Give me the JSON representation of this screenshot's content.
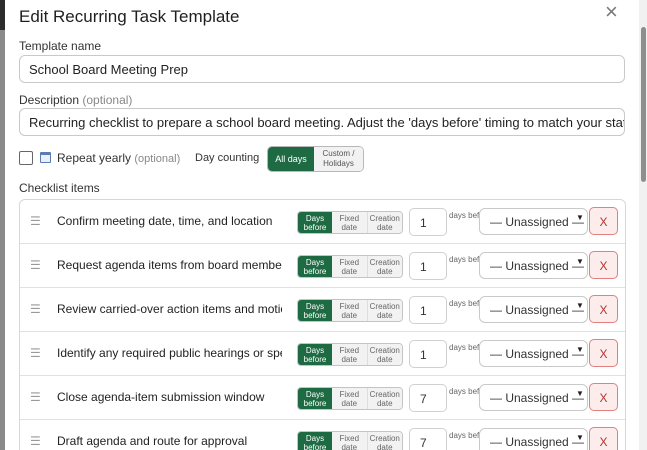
{
  "modal": {
    "title": "Edit Recurring Task Template",
    "close_label": "×"
  },
  "template_name": {
    "label": "Template name",
    "value": "School Board Meeting Prep"
  },
  "description": {
    "label": "Description",
    "optional": "(optional)",
    "value": "Recurring checklist to prepare a school board meeting. Adjust the 'days before' timing to match your state's noti"
  },
  "repeat": {
    "label": "Repeat yearly",
    "optional": "(optional)",
    "checked": false
  },
  "day_counting": {
    "label": "Day counting",
    "options": [
      "All days",
      "Custom / Holidays"
    ],
    "selected": "All days"
  },
  "checklist": {
    "label": "Checklist items",
    "mode_options": [
      "Days before",
      "Fixed date",
      "Creation date"
    ],
    "unit": "days before",
    "items": [
      {
        "text": "Confirm meeting date, time, and location",
        "days": "1",
        "assignee": "— Unassigned —",
        "delete": "X"
      },
      {
        "text": "Request agenda items from board members",
        "days": "1",
        "assignee": "— Unassigned —",
        "delete": "X"
      },
      {
        "text": "Review carried-over action items and motions",
        "days": "1",
        "assignee": "— Unassigned —",
        "delete": "X"
      },
      {
        "text": "Identify any required public hearings or special",
        "days": "1",
        "assignee": "— Unassigned —",
        "delete": "X"
      },
      {
        "text": "Close agenda-item submission window",
        "days": "7",
        "assignee": "— Unassigned —",
        "delete": "X"
      },
      {
        "text": "Draft agenda and route for approval",
        "days": "7",
        "assignee": "— Unassigned —",
        "delete": "X"
      }
    ]
  },
  "colors": {
    "accent": "#1e6b43",
    "danger": "#b53331"
  }
}
